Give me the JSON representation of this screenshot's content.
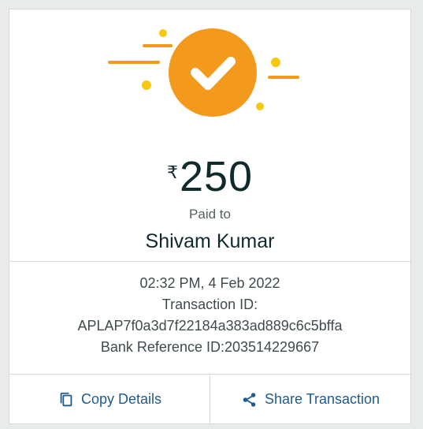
{
  "colors": {
    "accent_orange": "#f39a1c",
    "accent_yellow": "#f7c80d",
    "action_blue": "#1f5b8c",
    "text_dark": "#0f2a2d"
  },
  "success": {
    "icon": "checkmark-circle-icon"
  },
  "payment": {
    "currency_symbol": "₹",
    "amount": "250",
    "paid_to_label": "Paid to",
    "payee_name": "Shivam Kumar"
  },
  "details": {
    "datetime": "02:32 PM, 4 Feb 2022",
    "transaction_id_label": "Transaction ID:",
    "transaction_id": "APLAP7f0a3d7f22184a383ad889c6c5bffa",
    "bank_reference": "Bank Reference ID:203514229667"
  },
  "actions": {
    "copy": {
      "label": "Copy Details",
      "icon": "copy-icon"
    },
    "share": {
      "label": "Share Transaction",
      "icon": "share-icon"
    }
  }
}
